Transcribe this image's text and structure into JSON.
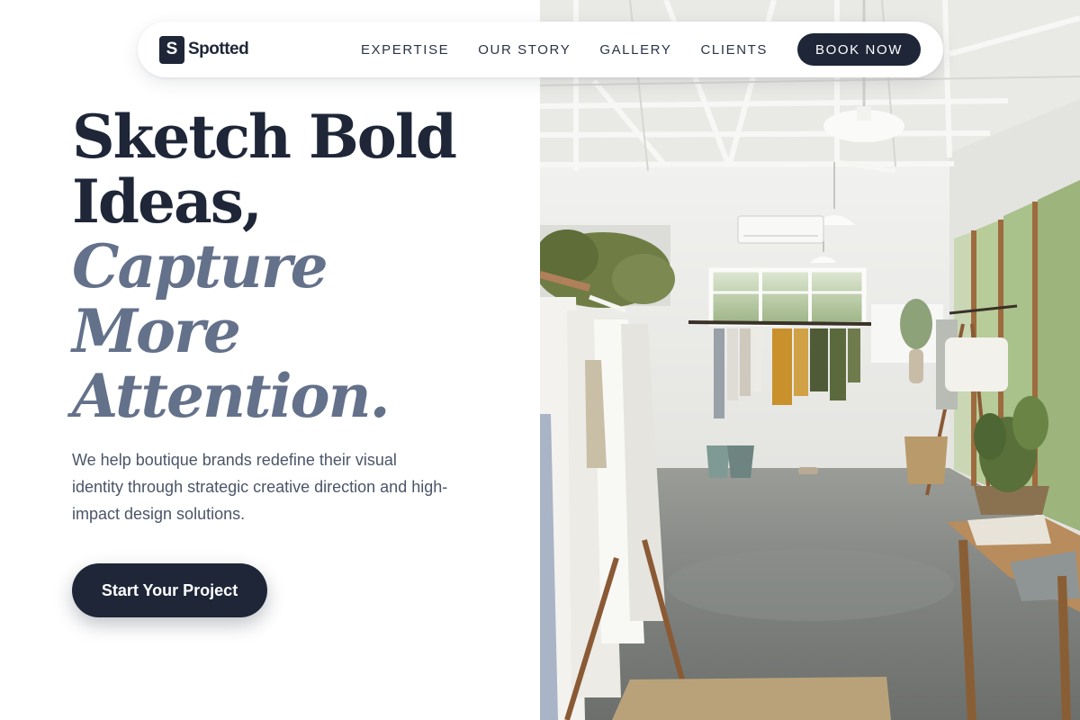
{
  "nav": {
    "logo_letter": "S",
    "logo_text": "Spotted",
    "links": [
      "EXPERTISE",
      "OUR STORY",
      "GALLERY",
      "CLIENTS"
    ],
    "book_label": "BOOK NOW"
  },
  "hero": {
    "headline_line1": "Sketch Bold",
    "headline_line2": "Ideas,",
    "headline_line3": "Capture",
    "headline_line4": "More",
    "headline_line5": "Attention.",
    "lead": "We help boutique brands redefine their visual identity through strategic creative direction and high-impact design solutions.",
    "cta_label": "Start Your Project"
  },
  "colors": {
    "navy": "#1e2638",
    "slate_accent": "#64718b",
    "body_text": "#4b5568"
  }
}
